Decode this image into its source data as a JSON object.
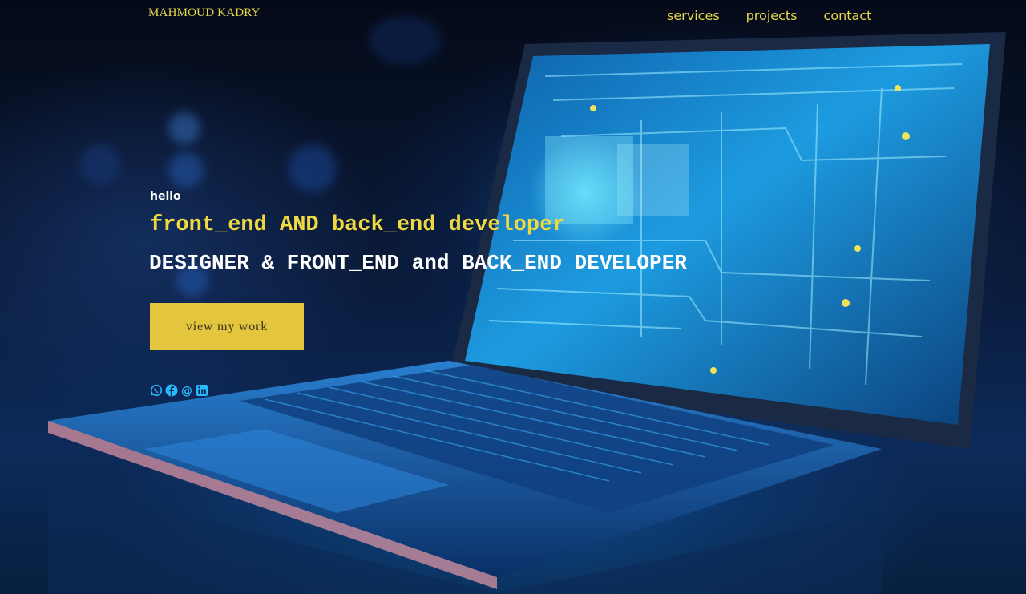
{
  "header": {
    "brand": "MAHMOUD KADRY",
    "nav": [
      {
        "label": "services"
      },
      {
        "label": "projects"
      },
      {
        "label": "contact"
      }
    ]
  },
  "hero": {
    "greeting": "hello",
    "headline": "front_end AND back_end developer",
    "subheadline": "DESIGNER & FRONT_END and BACK_END DEVELOPER",
    "cta_label": "view my work",
    "socials": [
      {
        "icon": "whatsapp-icon"
      },
      {
        "icon": "facebook-icon"
      },
      {
        "icon": "email-icon"
      },
      {
        "icon": "linkedin-icon"
      }
    ]
  },
  "colors": {
    "accent": "#e3c63e",
    "nav_text": "#e6d94a",
    "social_icons": "#27b9ff",
    "text_light": "#ffffff"
  }
}
